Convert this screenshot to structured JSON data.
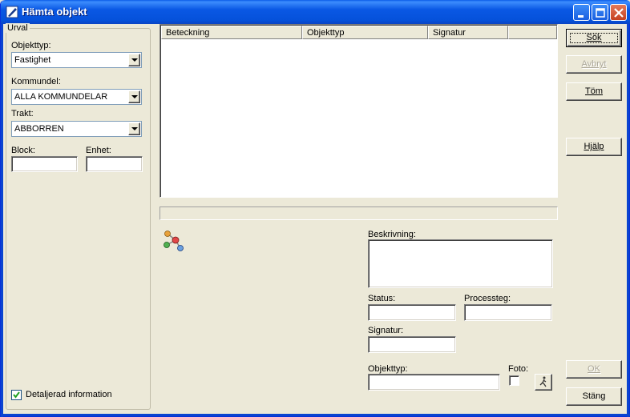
{
  "window": {
    "title": "Hämta objekt",
    "icons": {
      "app": "pen-icon",
      "minimize": "minimize-icon",
      "maximize": "maximize-icon",
      "close": "close-icon"
    }
  },
  "urval": {
    "legend": "Urval",
    "objekttyp_label": "Objekttyp:",
    "objekttyp_value": "Fastighet",
    "kommundel_label": "Kommundel:",
    "kommundel_value": "ALLA KOMMUNDELAR",
    "trakt_label": "Trakt:",
    "trakt_value": "ABBORREN",
    "block_label": "Block:",
    "block_value": "",
    "enhet_label": "Enhet:",
    "enhet_value": "",
    "detailed_label": "Detaljerad information",
    "detailed_checked": true
  },
  "results": {
    "columns": [
      "Beteckning",
      "Objekttyp",
      "Signatur",
      ""
    ]
  },
  "details": {
    "beskrivning_label": "Beskrivning:",
    "beskrivning_value": "",
    "status_label": "Status:",
    "status_value": "",
    "processteg_label": "Processteg:",
    "processteg_value": "",
    "signatur_label": "Signatur:",
    "signatur_value": "",
    "objekttyp_label": "Objekttyp:",
    "objekttyp_value": "",
    "foto_label": "Foto:",
    "foto_checked": false,
    "icons": {
      "graph": "molecule-icon",
      "walk": "walking-person-icon"
    }
  },
  "buttons": {
    "sok": "Sök",
    "avbryt": "Avbryt",
    "tom": "Töm",
    "hjalp": "Hjälp",
    "ok": "OK",
    "stang": "Stäng"
  },
  "colors": {
    "titlebar": "#0a58e4",
    "background": "#ece9d8",
    "disabled_text": "#aca899"
  }
}
